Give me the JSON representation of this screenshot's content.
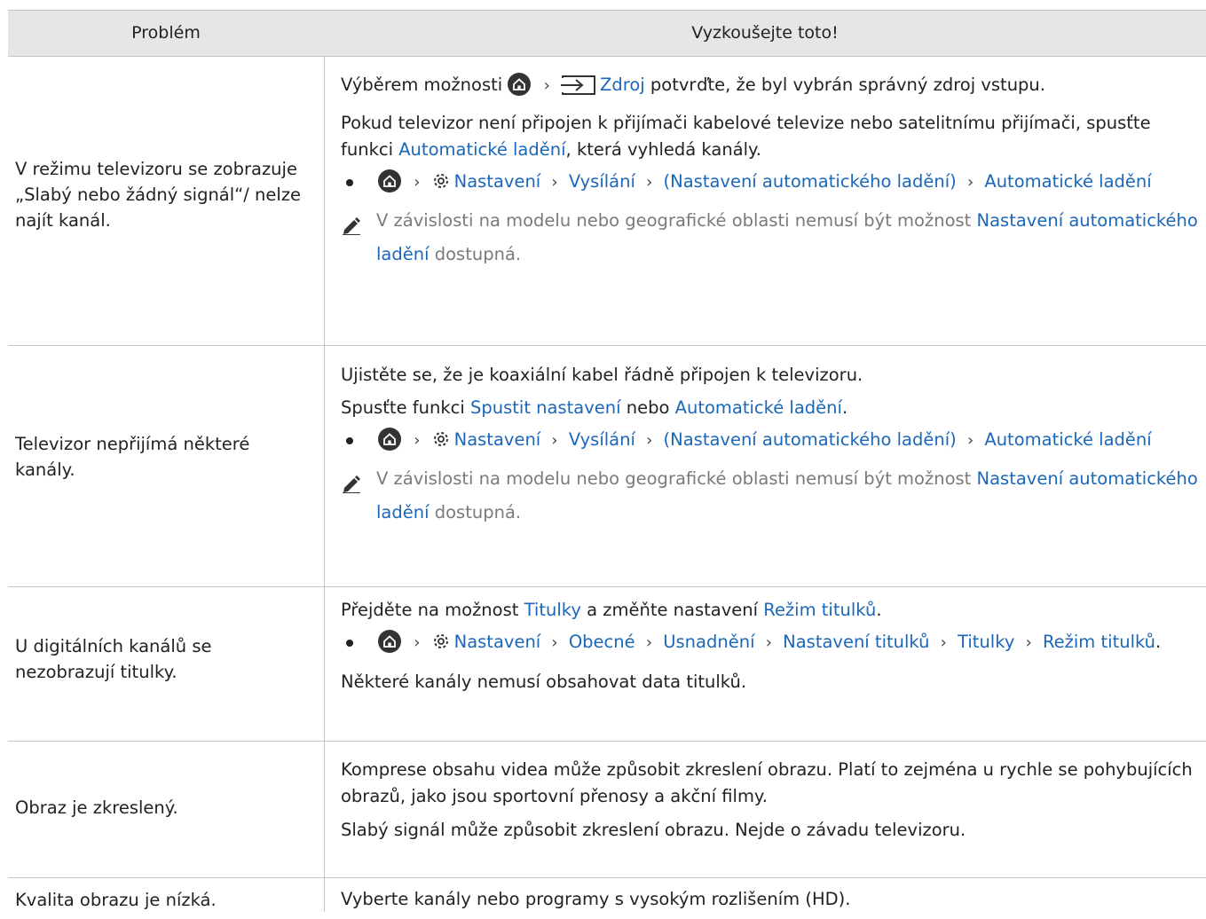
{
  "header": {
    "problem": "Problém",
    "solution": "Vyzkoušejte toto!"
  },
  "rows": {
    "r1": {
      "problem": "V režimu televizoru se zobrazuje „Slabý nebo žádný signál“/ nelze najít kanál.",
      "p1_a": "Výběrem možnosti",
      "p1_link": "Zdroj",
      "p1_b": "potvrďte, že byl vybrán správný zdroj vstupu.",
      "p2_a": "Pokud televizor není připojen k přijímači kabelové televize nebo satelitnímu přijímači, spusťte funkci",
      "p2_link": "Automatické ladění",
      "p2_b": ", která vyhledá kanály.",
      "path": [
        "Nastavení",
        "Vysílání",
        "(Nastavení automatického ladění)",
        "Automatické ladění"
      ],
      "note_a": "V závislosti na modelu nebo geografické oblasti nemusí být možnost",
      "note_link": "Nastavení automatického ladění",
      "note_b": "dostupná."
    },
    "r2": {
      "problem": "Televizor nepřijímá některé kanály.",
      "p1": "Ujistěte se, že je koaxiální kabel řádně připojen k televizoru.",
      "p2_a": "Spusťte funkci",
      "p2_link1": "Spustit nastavení",
      "p2_mid": "nebo",
      "p2_link2": "Automatické ladění",
      "p2_end": ".",
      "path": [
        "Nastavení",
        "Vysílání",
        "(Nastavení automatického ladění)",
        "Automatické ladění"
      ],
      "note_a": "V závislosti na modelu nebo geografické oblasti nemusí být možnost",
      "note_link": "Nastavení automatického ladění",
      "note_b": "dostupná."
    },
    "r3": {
      "problem": "U digitálních kanálů se nezobrazují titulky.",
      "p1_a": "Přejděte na možnost",
      "p1_link1": "Titulky",
      "p1_mid": "a změňte nastavení",
      "p1_link2": "Režim titulků",
      "p1_end": ".",
      "path": [
        "Nastavení",
        "Obecné",
        "Usnadnění",
        "Nastavení titulků",
        "Titulky",
        "Režim titulků"
      ],
      "path_end": ".",
      "p3": "Některé kanály nemusí obsahovat data titulků."
    },
    "r4": {
      "problem": "Obraz je zkreslený.",
      "p1": "Komprese obsahu videa může způsobit zkreslení obrazu. Platí to zejména u rychle se pohybujících obrazů, jako jsou sportovní přenosy a akční filmy.",
      "p2": "Slabý signál může způsobit zkreslení obrazu. Nejde o závadu televizoru."
    },
    "r5": {
      "problem": "Kvalita obrazu je nízká.",
      "p1": "Vyberte kanály nebo programy s vysokým rozlišením (HD)."
    }
  },
  "icons": {
    "home": "home-icon",
    "settings": "gear-icon",
    "source": "source-icon",
    "note": "pencil-note-icon",
    "chevron": "chevron-right-icon"
  },
  "colors": {
    "link": "#1b67b9",
    "header_bg": "#e6e6e6",
    "border": "#c4c4c4",
    "note_text": "#7a7a7a"
  }
}
